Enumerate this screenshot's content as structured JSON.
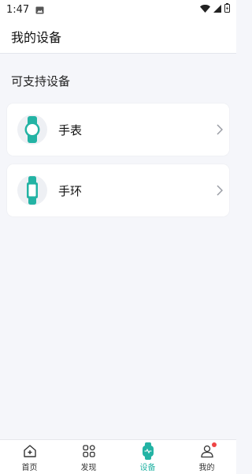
{
  "status_bar": {
    "time": "1:47"
  },
  "header": {
    "title": "我的设备"
  },
  "section": {
    "title": "可支持设备"
  },
  "devices": [
    {
      "label": "手表",
      "icon": "watch-icon"
    },
    {
      "label": "手环",
      "icon": "band-icon"
    }
  ],
  "bottom_nav": {
    "items": [
      {
        "label": "首页",
        "icon": "home-icon"
      },
      {
        "label": "发现",
        "icon": "grid-icon"
      },
      {
        "label": "设备",
        "icon": "device-watch-icon",
        "active": true
      },
      {
        "label": "我的",
        "icon": "user-icon"
      }
    ]
  },
  "colors": {
    "accent": "#23b3a4",
    "background": "#f5f6fa",
    "badge": "#ee4444"
  }
}
